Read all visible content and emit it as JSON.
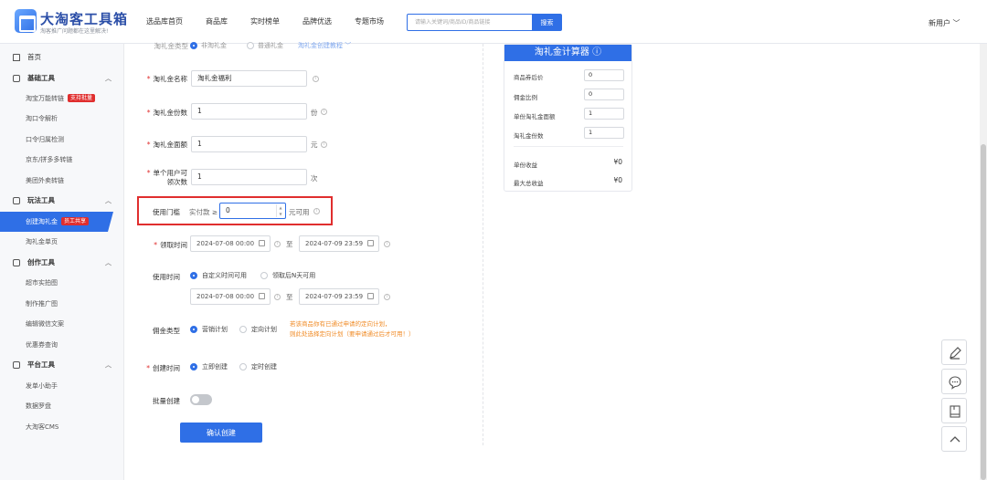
{
  "brand": {
    "title": "大淘客工具箱",
    "subtitle": "淘客推广问题都在这里解决!"
  },
  "nav": [
    "选品库首页",
    "商品库",
    "实时榜单",
    "品牌优选",
    "专题市场"
  ],
  "search": {
    "placeholder": "请输入关键词/商品ID/商品链接",
    "button": "搜索"
  },
  "user": {
    "label": "新用户 ﹀"
  },
  "sidebar": {
    "home": "首页",
    "groups": [
      {
        "label": "基础工具",
        "items": [
          {
            "label": "淘宝万能转链",
            "badge": "支持批量"
          },
          {
            "label": "淘口令解析"
          },
          {
            "label": "口令归属检测"
          },
          {
            "label": "京东/拼多多转链"
          },
          {
            "label": "美团外卖转链"
          }
        ]
      },
      {
        "label": "玩法工具",
        "items": [
          {
            "label": "创建淘礼金",
            "badge": "员工共享",
            "active": true
          },
          {
            "label": "淘礼金单页"
          }
        ]
      },
      {
        "label": "创作工具",
        "items": [
          {
            "label": "超市实拍图"
          },
          {
            "label": "制作推广图"
          },
          {
            "label": "编辑微信文案"
          },
          {
            "label": "优惠券查询"
          }
        ]
      },
      {
        "label": "平台工具",
        "items": [
          {
            "label": "发单小助手"
          },
          {
            "label": "数据罗盘"
          },
          {
            "label": "大淘客CMS"
          }
        ]
      }
    ]
  },
  "form": {
    "top_partial": {
      "label": "淘礼金类型",
      "opt1": "非淘礼金",
      "opt2": "普通礼金",
      "link": "淘礼金创建教程 ﹀"
    },
    "name": {
      "label": "淘礼金名称",
      "value": "淘礼金福利"
    },
    "count": {
      "label": "淘礼金份数",
      "value": "1",
      "unit": "份"
    },
    "amount": {
      "label": "淘礼金面额",
      "value": "1",
      "unit": "元"
    },
    "per_user": {
      "label_line1": "单个用户可",
      "label_line2": "领次数",
      "value": "1",
      "unit": "次"
    },
    "threshold": {
      "label": "使用门槛",
      "prefix": "实付款 ≥",
      "value": "0",
      "suffix": "元可用"
    },
    "claim_time": {
      "label": "领取时间",
      "start": "2024-07-08 00:00",
      "to": "至",
      "end": "2024-07-09 23:59"
    },
    "use_time": {
      "label": "使用时间",
      "opt1": "自定义时间可用",
      "opt2": "领取后N天可用",
      "start": "2024-07-08 00:00",
      "to": "至",
      "end": "2024-07-09 23:59"
    },
    "commission": {
      "label": "佣金类型",
      "opt1": "营销计划",
      "opt2": "定向计划",
      "note1": "若该商品你有已通过申请的定向计划，",
      "note2": "则此处选择定向计划（要申请通过后才可用！）"
    },
    "create_time": {
      "label": "创建时间",
      "opt1": "立即创建",
      "opt2": "定时创建"
    },
    "batch": {
      "label": "批量创建"
    },
    "submit": "确认创建"
  },
  "calculator": {
    "title": "淘礼金计算器 ⓘ",
    "rows": [
      {
        "label": "商品券后价",
        "value": "0"
      },
      {
        "label": "佣金比例",
        "value": "0"
      },
      {
        "label": "单份淘礼金面额",
        "value": "1"
      },
      {
        "label": "淘礼金份数",
        "value": "1"
      }
    ],
    "single_income": {
      "label": "单份收益",
      "value": "¥0"
    },
    "max_income": {
      "label": "最大总收益",
      "value": "¥0"
    }
  }
}
